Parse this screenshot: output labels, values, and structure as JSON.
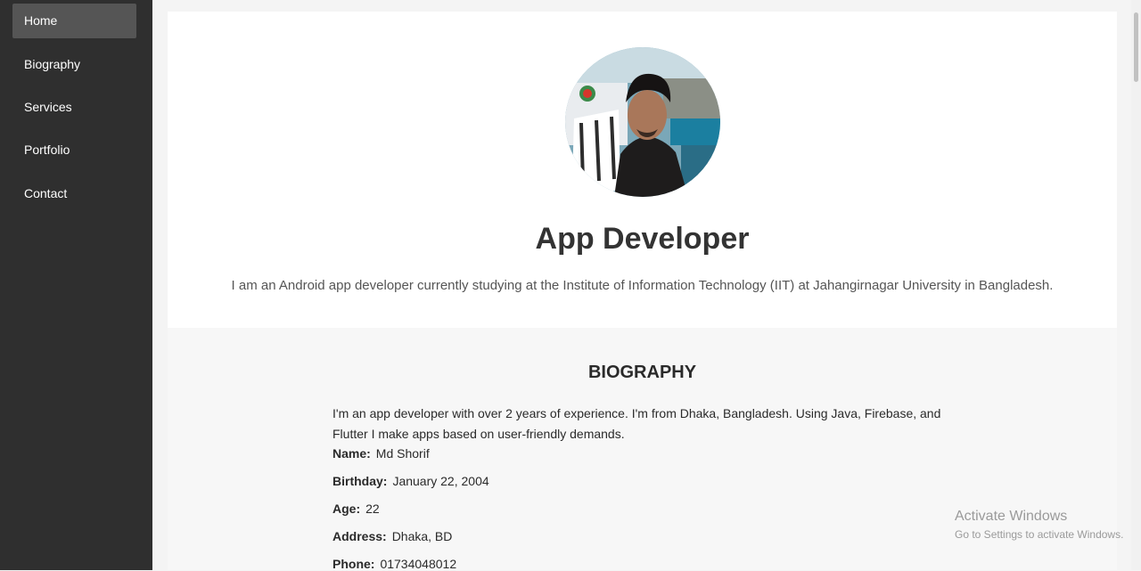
{
  "sidebar": {
    "items": [
      {
        "label": "Home",
        "active": true
      },
      {
        "label": "Biography",
        "active": false
      },
      {
        "label": "Services",
        "active": false
      },
      {
        "label": "Portfolio",
        "active": false
      },
      {
        "label": "Contact",
        "active": false
      }
    ]
  },
  "hero": {
    "title": "App Developer",
    "description": "I am an Android app developer currently studying at the Institute of Information Technology (IIT) at Jahangirnagar University in Bangladesh."
  },
  "biography": {
    "title": "BIOGRAPHY",
    "text": "I'm an app developer with over 2 years of experience. I'm from Dhaka, Bangladesh. Using Java, Firebase, and Flutter I make apps based on user-friendly demands.",
    "fields": [
      {
        "label": "Name:",
        "value": "Md Shorif"
      },
      {
        "label": "Birthday:",
        "value": "January 22, 2004"
      },
      {
        "label": "Age:",
        "value": "22"
      },
      {
        "label": "Address:",
        "value": "Dhaka, BD"
      },
      {
        "label": "Phone:",
        "value": "01734048012"
      }
    ]
  },
  "watermark": {
    "title": "Activate Windows",
    "subtitle": "Go to Settings to activate Windows."
  },
  "colors": {
    "sidebar_bg": "#2f2f2f",
    "active_item_bg": "#555555",
    "heading_text": "#333333"
  }
}
